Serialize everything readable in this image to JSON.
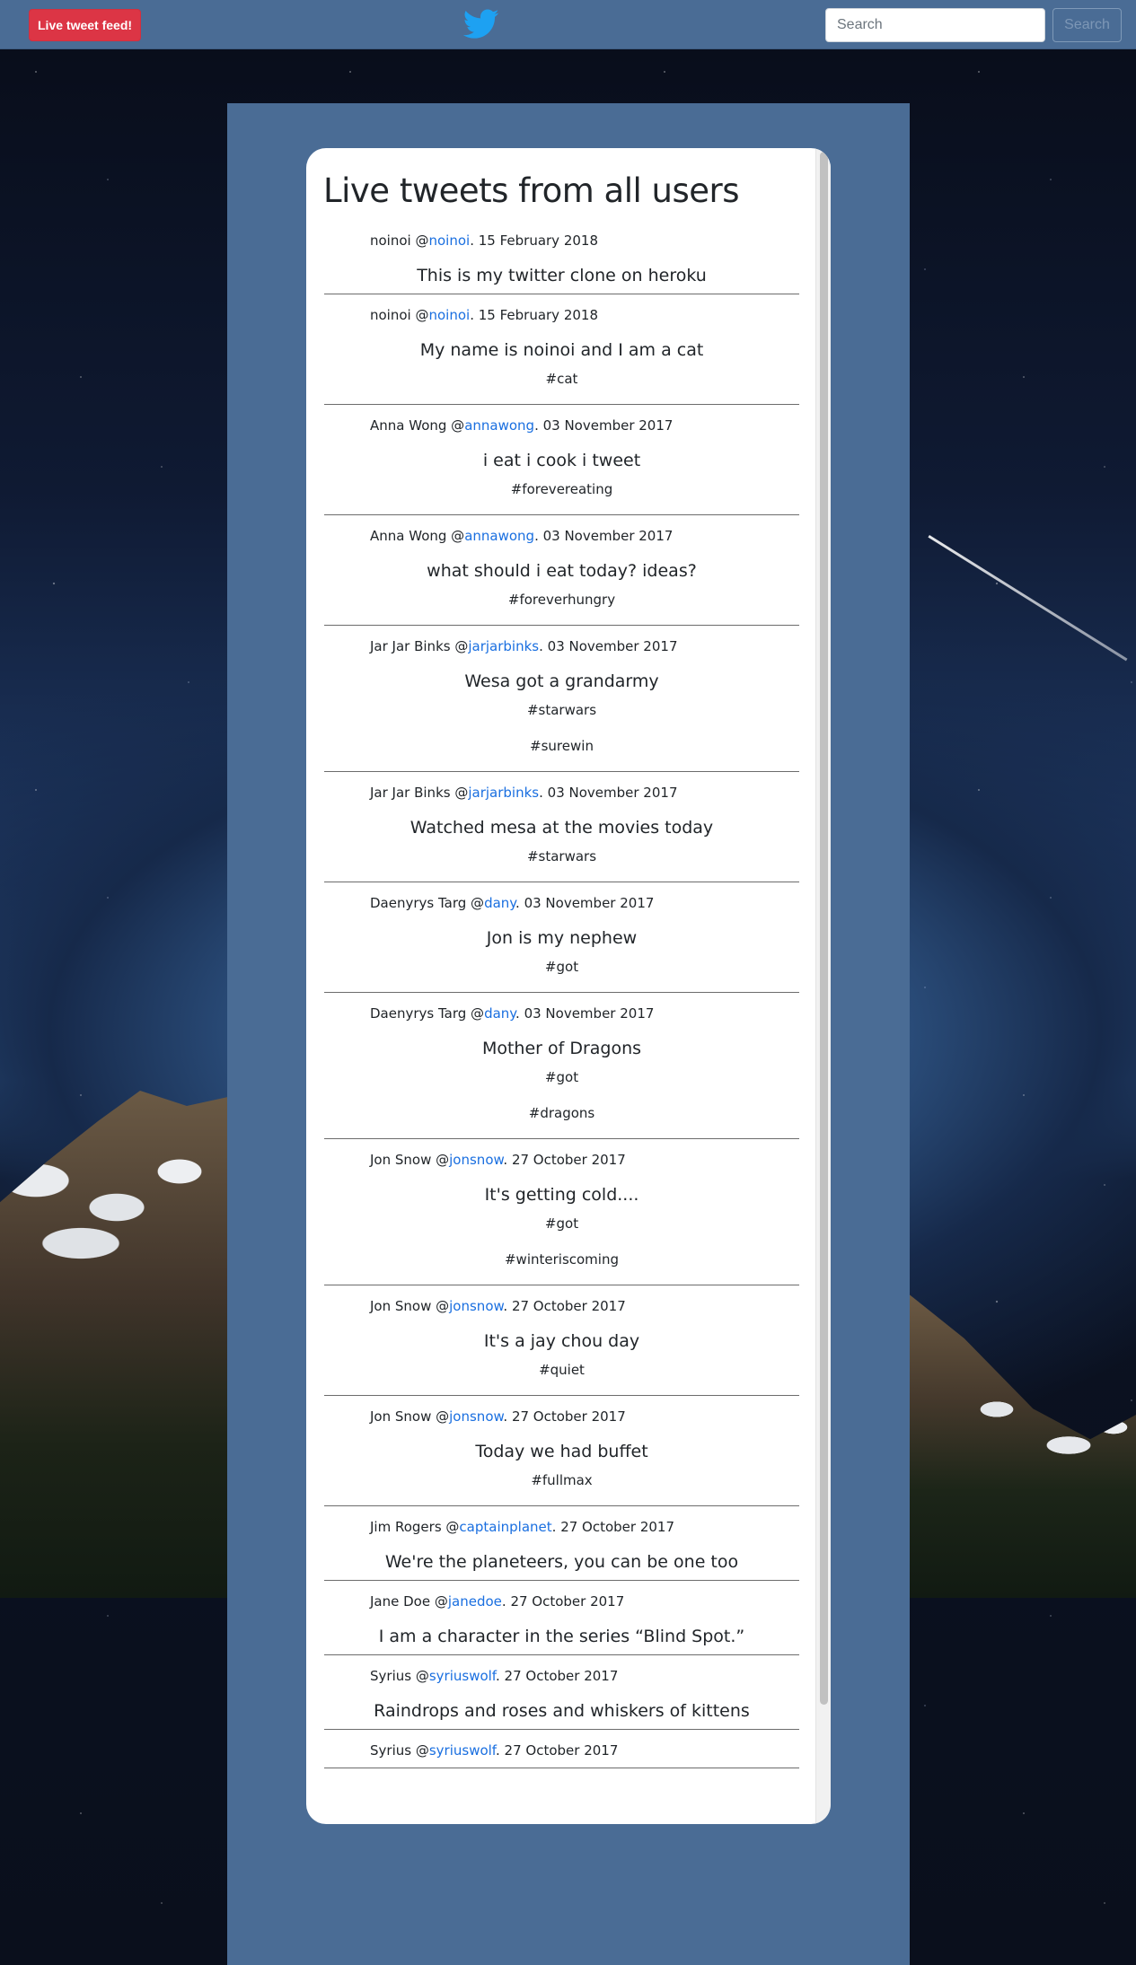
{
  "navbar": {
    "brand_button": "Live tweet feed!",
    "logo_icon": "twitter-bird-icon",
    "search_placeholder": "Search",
    "search_button": "Search"
  },
  "colors": {
    "navbar_bg": "#4a6c95",
    "brand_red": "#dc3545",
    "link_blue": "#1a6fe0",
    "card_bg": "#ffffff"
  },
  "feed": {
    "title": "Live tweets from all users",
    "tweets": [
      {
        "name": "noinoi",
        "handle": "noinoi",
        "date": "15 February 2018",
        "text": "This is my twitter clone on heroku",
        "tags": []
      },
      {
        "name": "noinoi",
        "handle": "noinoi",
        "date": "15 February 2018",
        "text": "My name is noinoi and I am a cat",
        "tags": [
          "#cat"
        ]
      },
      {
        "name": "Anna Wong",
        "handle": "annawong",
        "date": "03 November 2017",
        "text": "i eat i cook i tweet",
        "tags": [
          "#forevereating"
        ]
      },
      {
        "name": "Anna Wong",
        "handle": "annawong",
        "date": "03 November 2017",
        "text": "what should i eat today? ideas?",
        "tags": [
          "#foreverhungry"
        ]
      },
      {
        "name": "Jar Jar Binks",
        "handle": "jarjarbinks",
        "date": "03 November 2017",
        "text": "Wesa got a grandarmy",
        "tags": [
          "#starwars",
          "#surewin"
        ]
      },
      {
        "name": "Jar Jar Binks",
        "handle": "jarjarbinks",
        "date": "03 November 2017",
        "text": "Watched mesa at the movies today",
        "tags": [
          "#starwars"
        ]
      },
      {
        "name": "Daenyrys Targ",
        "handle": "dany",
        "date": "03 November 2017",
        "text": "Jon is my nephew",
        "tags": [
          "#got"
        ]
      },
      {
        "name": "Daenyrys Targ",
        "handle": "dany",
        "date": "03 November 2017",
        "text": "Mother of Dragons",
        "tags": [
          "#got",
          "#dragons"
        ]
      },
      {
        "name": "Jon Snow",
        "handle": "jonsnow",
        "date": "27 October 2017",
        "text": "It's getting cold....",
        "tags": [
          "#got",
          "#winteriscoming"
        ]
      },
      {
        "name": "Jon Snow",
        "handle": "jonsnow",
        "date": "27 October 2017",
        "text": "It's a jay chou day",
        "tags": [
          "#quiet"
        ]
      },
      {
        "name": "Jon Snow",
        "handle": "jonsnow",
        "date": "27 October 2017",
        "text": "Today we had buffet",
        "tags": [
          "#fullmax"
        ]
      },
      {
        "name": "Jim Rogers",
        "handle": "captainplanet",
        "date": "27 October 2017",
        "text": "We're the planeteers, you can be one too",
        "tags": []
      },
      {
        "name": "Jane Doe",
        "handle": "janedoe",
        "date": "27 October 2017",
        "text": "I am a character in the series “Blind Spot.”",
        "tags": []
      },
      {
        "name": "Syrius",
        "handle": "syriuswolf",
        "date": "27 October 2017",
        "text": "Raindrops and roses and whiskers of kittens",
        "tags": []
      },
      {
        "name": "Syrius",
        "handle": "syriuswolf",
        "date": "27 October 2017",
        "text": "",
        "tags": []
      }
    ]
  }
}
